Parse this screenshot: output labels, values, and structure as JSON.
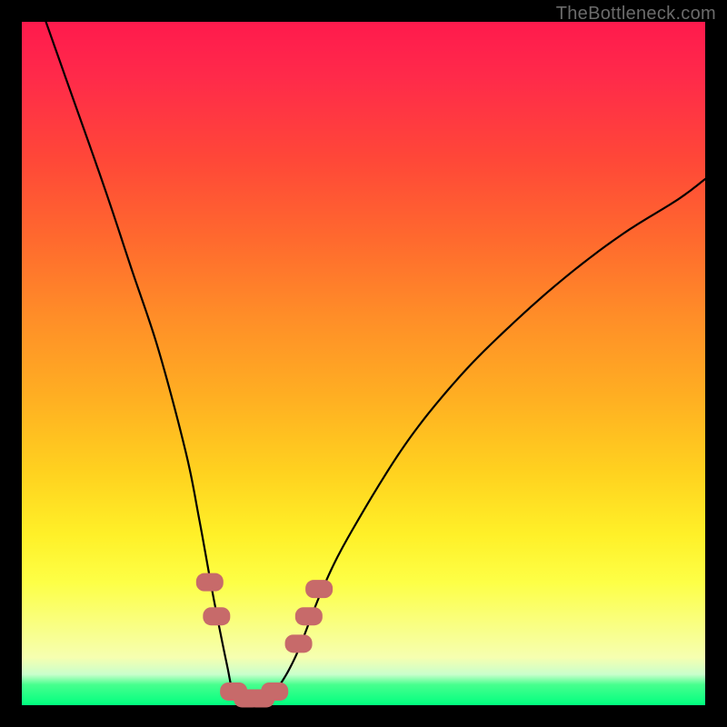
{
  "watermark": "TheBottleneck.com",
  "colors": {
    "background": "#000000",
    "gradient_top": "#ff1a4d",
    "gradient_bottom": "#00ff7f",
    "curve": "#000000",
    "marker": "#c76a6a"
  },
  "chart_data": {
    "type": "line",
    "title": "",
    "xlabel": "",
    "ylabel": "",
    "xlim": [
      0,
      100
    ],
    "ylim": [
      0,
      100
    ],
    "series": [
      {
        "name": "bottleneck-curve",
        "x": [
          0,
          6,
          12,
          16,
          20,
          24,
          26,
          28,
          30,
          31,
          33,
          35,
          37,
          40,
          44,
          48,
          56,
          64,
          72,
          80,
          88,
          96,
          100
        ],
        "values": [
          110,
          93,
          76,
          64,
          52,
          37,
          27,
          16,
          6,
          2,
          1,
          1,
          2,
          7,
          17,
          25,
          38,
          48,
          56,
          63,
          69,
          74,
          77
        ]
      }
    ],
    "markers": [
      {
        "x": 27.5,
        "y": 18,
        "label": "marker-left-upper"
      },
      {
        "x": 28.5,
        "y": 13,
        "label": "marker-left-lower"
      },
      {
        "x": 31,
        "y": 2,
        "label": "marker-flat-1"
      },
      {
        "x": 33,
        "y": 1,
        "label": "marker-flat-2"
      },
      {
        "x": 35,
        "y": 1,
        "label": "marker-flat-3"
      },
      {
        "x": 37,
        "y": 2,
        "label": "marker-flat-4"
      },
      {
        "x": 40.5,
        "y": 9,
        "label": "marker-right-lower"
      },
      {
        "x": 42,
        "y": 13,
        "label": "marker-right-mid"
      },
      {
        "x": 43.5,
        "y": 17,
        "label": "marker-right-upper"
      }
    ]
  }
}
